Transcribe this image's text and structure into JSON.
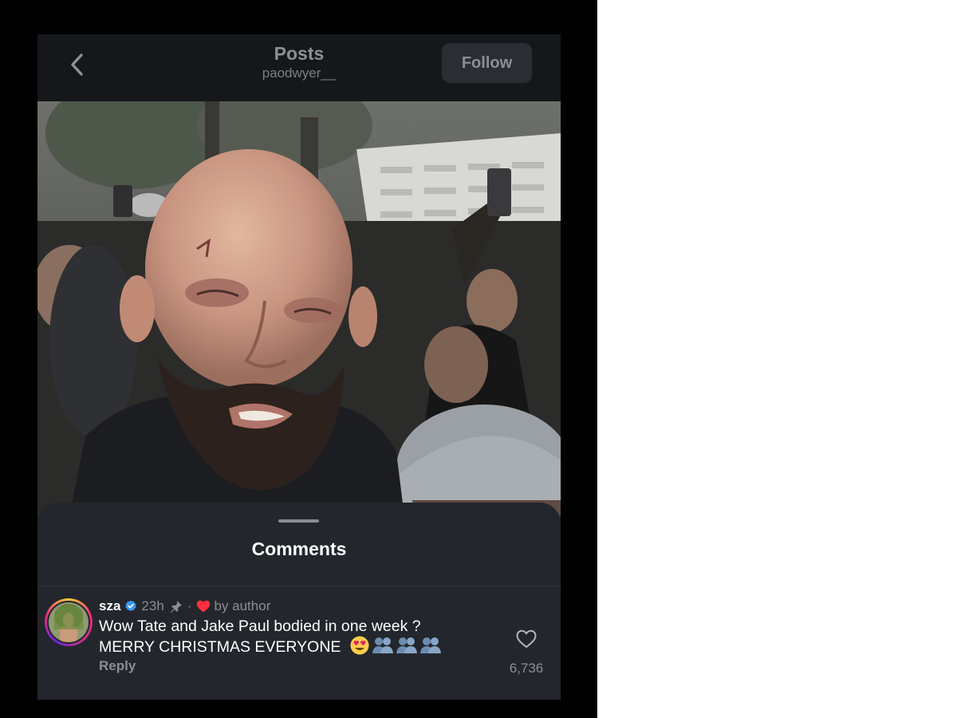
{
  "header": {
    "title": "Posts",
    "username": "paodwyer__",
    "follow_label": "Follow"
  },
  "comments_sheet": {
    "title": "Comments",
    "comment": {
      "username": "sza",
      "time": "23h",
      "separator": "·",
      "liked_by": "by author",
      "text_line1": "Wow Tate and Jake Paul bodied in one week ?",
      "text_line2": "MERRY CHRISTMAS EVERYONE",
      "emojis": [
        "heart-eyes-emoji",
        "people-silhouettes-emoji",
        "people-silhouettes-emoji",
        "people-silhouettes-emoji"
      ],
      "reply_label": "Reply",
      "like_count": "6,736"
    }
  },
  "colors": {
    "header_bg": "#15171b",
    "sheet_bg": "#23262c",
    "verified_blue": "#3897f0",
    "heart_red": "#ff3040"
  }
}
